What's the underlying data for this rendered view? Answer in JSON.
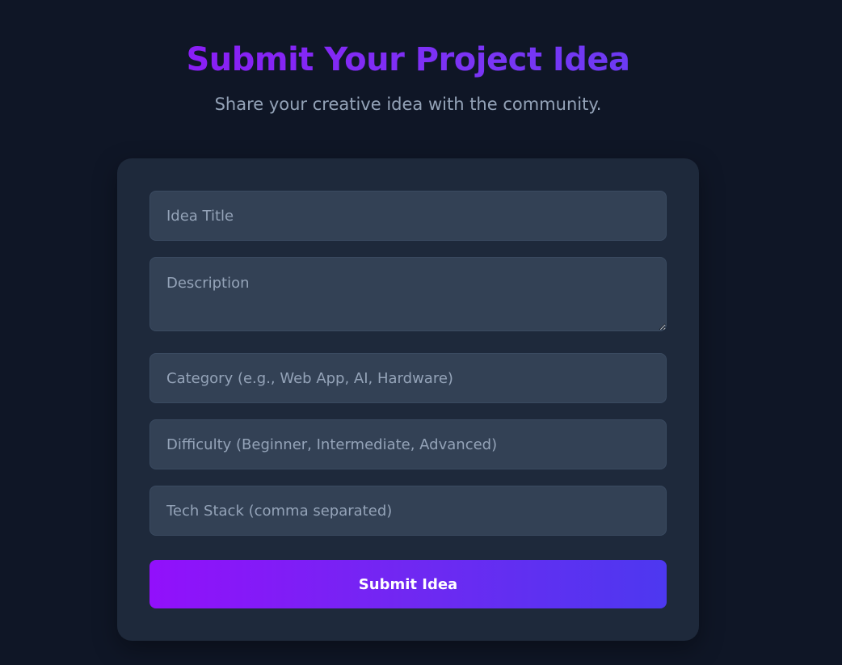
{
  "header": {
    "title": "Submit Your Project Idea",
    "subtitle": "Share your creative idea with the community."
  },
  "form": {
    "fields": {
      "title": {
        "placeholder": "Idea Title",
        "value": ""
      },
      "description": {
        "placeholder": "Description",
        "value": ""
      },
      "category": {
        "placeholder": "Category (e.g., Web App, AI, Hardware)",
        "value": ""
      },
      "difficulty": {
        "placeholder": "Difficulty (Beginner, Intermediate, Advanced)",
        "value": ""
      },
      "tech_stack": {
        "placeholder": "Tech Stack (comma separated)",
        "value": ""
      }
    },
    "submit_label": "Submit Idea"
  },
  "colors": {
    "background": "#0f1626",
    "card": "#1e293b",
    "field": "#334155",
    "accent_start": "#9210fb",
    "accent_end": "#4d38f0"
  }
}
